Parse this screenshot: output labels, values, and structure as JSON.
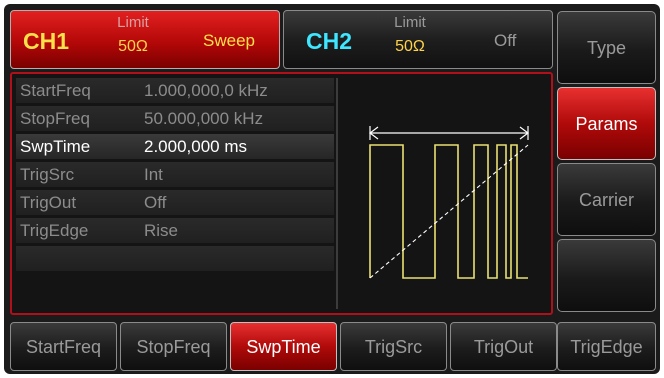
{
  "channels": {
    "ch1": {
      "name": "CH1",
      "limit_label": "Limit",
      "limit_value": "50Ω",
      "mode": "Sweep",
      "color": "#ffe14a",
      "selected": true
    },
    "ch2": {
      "name": "CH2",
      "limit_label": "Limit",
      "limit_value": "50Ω",
      "mode": "Off",
      "color": "#3ee6ff",
      "selected": false
    }
  },
  "params": [
    {
      "name": "StartFreq",
      "value": "1.000,000,0 kHz"
    },
    {
      "name": "StopFreq",
      "value": "50.000,000 kHz"
    },
    {
      "name": "SwpTime",
      "value": "2.000,000 ms",
      "active": true
    },
    {
      "name": "TrigSrc",
      "value": "Int"
    },
    {
      "name": "TrigOut",
      "value": "Off"
    },
    {
      "name": "TrigEdge",
      "value": "Rise"
    },
    {
      "name": "",
      "value": ""
    }
  ],
  "waveform": {
    "type": "linear-sweep",
    "trace_color": "#e8e070",
    "marker_color": "#ffffff"
  },
  "softkeys": [
    {
      "label": "Type",
      "active": false
    },
    {
      "label": "Params",
      "active": true
    },
    {
      "label": "Carrier",
      "active": false
    },
    {
      "label": "",
      "active": false
    }
  ],
  "bottom_menu": [
    {
      "label": "StartFreq",
      "active": false
    },
    {
      "label": "StopFreq",
      "active": false
    },
    {
      "label": "SwpTime",
      "active": true
    },
    {
      "label": "TrigSrc",
      "active": false
    },
    {
      "label": "TrigOut",
      "active": false
    },
    {
      "label": "TrigEdge",
      "active": false
    }
  ],
  "colors": {
    "accent_red": "#c0101a",
    "background": "#1b1b1b",
    "active_text": "#ffffff",
    "inactive_text": "#8c8c8c"
  }
}
